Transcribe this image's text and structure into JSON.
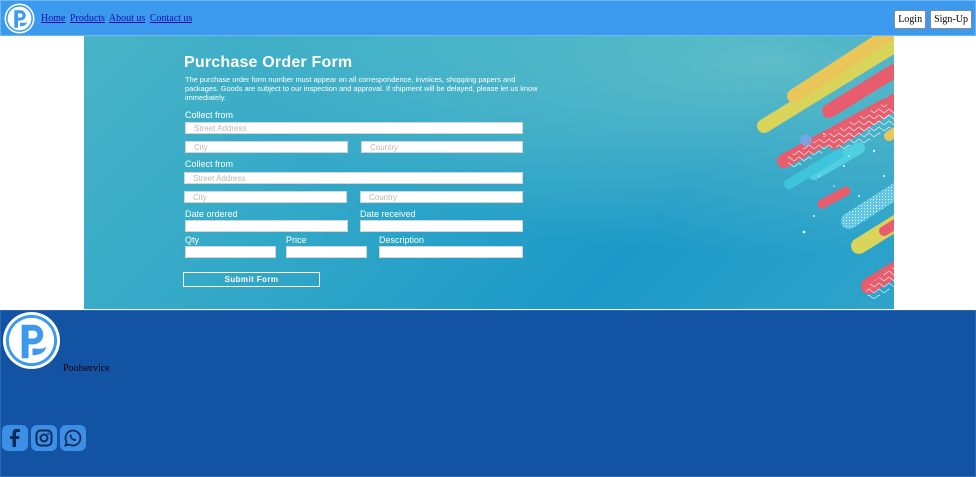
{
  "header": {
    "logo_icon": "p-logo-icon",
    "nav": [
      "Home",
      "Products",
      "About us",
      "Contact us"
    ],
    "login_label": "Login",
    "signup_label": "Sign-Up"
  },
  "form": {
    "title": "Purchase Order Form",
    "description": "The purchase order form number must appear on all correspondence, invoices, shopping papers and packages. Goods are subject to our inspection and approval. If shipment will be delayed, please let us know immediately.",
    "collect_from_1": {
      "label": "Collect from",
      "street_placeholder": "Street Address",
      "city_placeholder": "City",
      "country_placeholder": "Country"
    },
    "collect_from_2": {
      "label": "Collect from",
      "street_placeholder": "Street Address",
      "city_placeholder": "City",
      "country_placeholder": "Country"
    },
    "date_ordered_label": "Date ordered",
    "date_received_label": "Date received",
    "qty_label": "Qty",
    "price_label": "Price",
    "description_label": "Description",
    "submit_label": "Submit Form"
  },
  "footer": {
    "logo_icon": "p-logo-icon",
    "brand": "Poolservice",
    "social": [
      "facebook-icon",
      "instagram-icon",
      "whatsapp-icon"
    ]
  },
  "colors": {
    "header_bg": "#3b9aee",
    "footer_bg": "#1253a4",
    "banner_bg": "#2ba6c8",
    "social_bg": "#3d8fe6"
  }
}
